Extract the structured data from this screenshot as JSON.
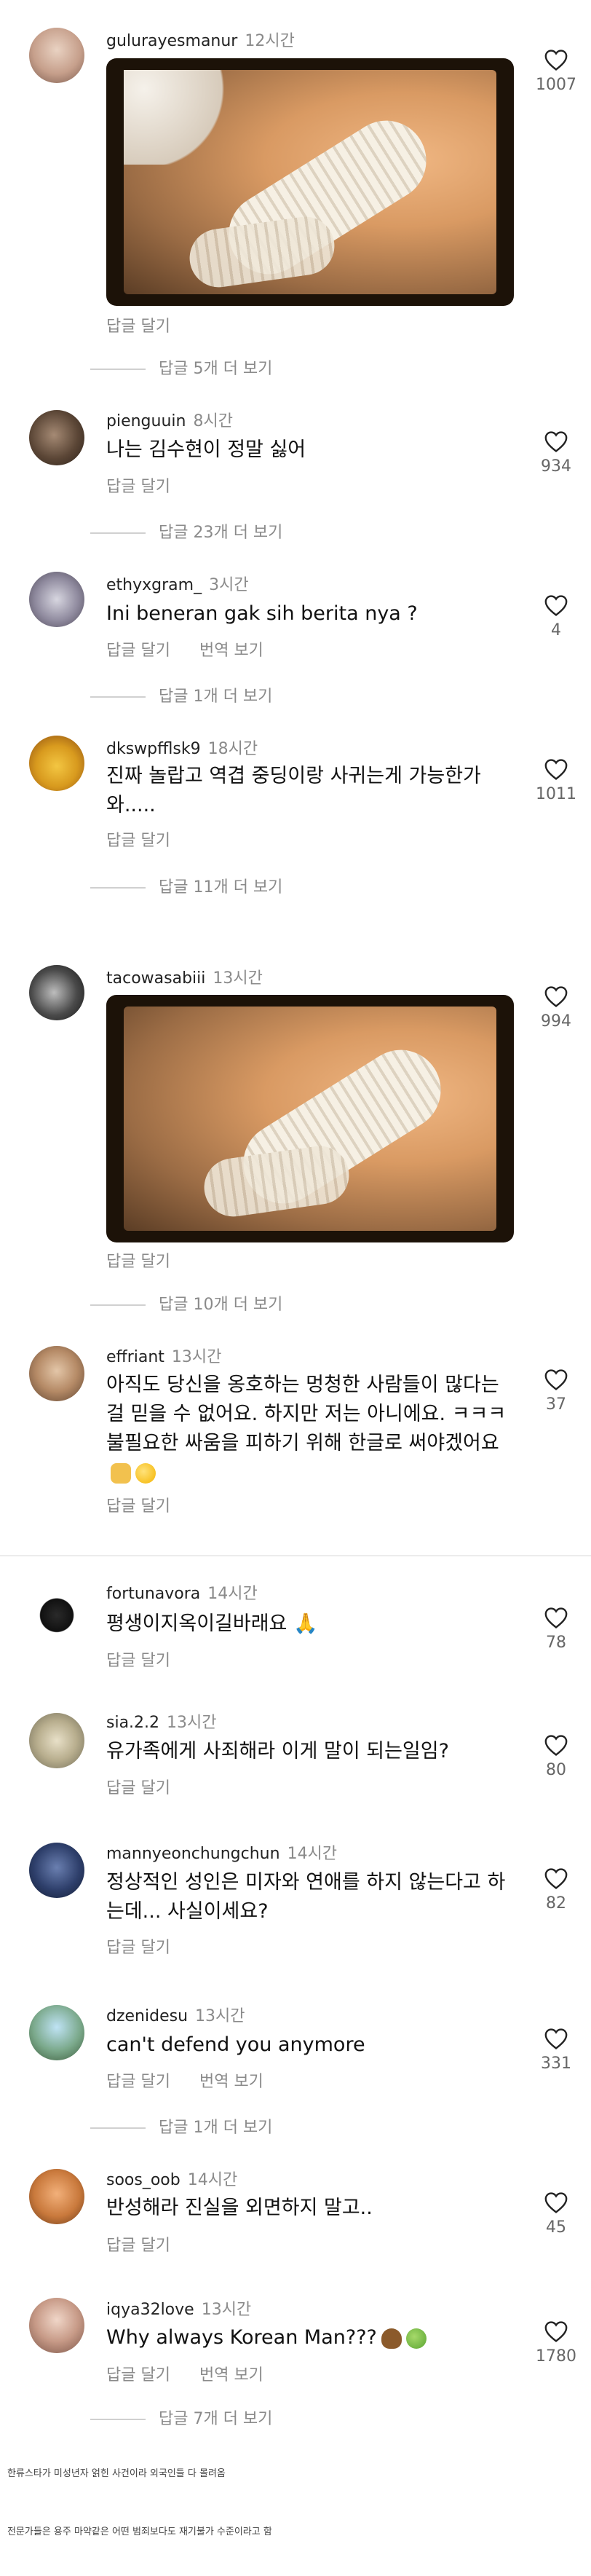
{
  "colors": {
    "secondary_text": "#8a8a8a",
    "divider": "#ececec"
  },
  "icons": {
    "like": "heart-outline-icon"
  },
  "comments": [
    {
      "username": "gulurayesmanur",
      "time": "12시간",
      "text": "",
      "has_image": true,
      "reply": "답글 달기",
      "translate": "",
      "more": "답글 5개 더 보기",
      "likes": "1007"
    },
    {
      "username": "pienguuin",
      "time": "8시간",
      "text": "나는 김수현이 정말 싫어",
      "reply": "답글 달기",
      "translate": "",
      "more": "답글 23개 더 보기",
      "likes": "934"
    },
    {
      "username": "ethyxgram_",
      "time": "3시간",
      "text": "Ini beneran gak sih berita nya ?",
      "reply": "답글 달기",
      "translate": "번역 보기",
      "more": "답글 1개 더 보기",
      "likes": "4"
    },
    {
      "username": "dkswpfflsk9",
      "time": "18시간",
      "text": "진짜 놀랍고 역겹 중딩이랑 사귀는게 가능한가 와.....",
      "reply": "답글 달기",
      "translate": "",
      "more": "답글 11개 더 보기",
      "likes": "1011"
    },
    {
      "username": "tacowasabiii",
      "time": "13시간",
      "text": "",
      "has_image": true,
      "reply": "답글 달기",
      "translate": "",
      "more": "답글 10개 더 보기",
      "likes": "994"
    },
    {
      "username": "effriant",
      "time": "13시간",
      "text": "아직도 당신을 옹호하는 멍청한 사람들이 많다는 걸 믿을 수 없어요. 하지만 저는 아니에요. ㅋㅋㅋ 불필요한 싸움을 피하기 위해 한글로 써야겠어요",
      "reply": "답글 달기",
      "translate": "",
      "more": "",
      "likes": "37"
    },
    {
      "username": "fortunavora",
      "time": "14시간",
      "text": "평생이지옥이길바래요 🙏",
      "reply": "답글 달기",
      "translate": "",
      "more": "",
      "likes": "78"
    },
    {
      "username": "sia.2.2",
      "time": "13시간",
      "text": "유가족에게 사죄해라 이게 말이 되는일임?",
      "reply": "답글 달기",
      "translate": "",
      "more": "",
      "likes": "80"
    },
    {
      "username": "mannyeonchungchun",
      "time": "14시간",
      "text": "정상적인 성인은 미자와 연애를 하지 않는다고 하는데... 사실이세요?",
      "reply": "답글 달기",
      "translate": "",
      "more": "",
      "likes": "82"
    },
    {
      "username": "dzenidesu",
      "time": "13시간",
      "text": "can't defend you anymore",
      "reply": "답글 달기",
      "translate": "번역 보기",
      "more": "답글 1개 더 보기",
      "likes": "331"
    },
    {
      "username": "soos_oob",
      "time": "14시간",
      "text": "반성해라 진실을 외면하지 말고..",
      "reply": "답글 달기",
      "translate": "",
      "more": "",
      "likes": "45"
    },
    {
      "username": "iqya32love",
      "time": "13시간",
      "text": "Why always Korean Man???",
      "reply": "답글 달기",
      "translate": "번역 보기",
      "more": "답글 7개 더 보기",
      "likes": "1780"
    }
  ],
  "footer": {
    "line1": "한류스타가 미성년자 얽힌 사건이라 외국인들 다 몰려옴",
    "line2": "전문가들은 용주 마약같은 어떤 범죄보다도 재기불가 수준이라고 함"
  }
}
